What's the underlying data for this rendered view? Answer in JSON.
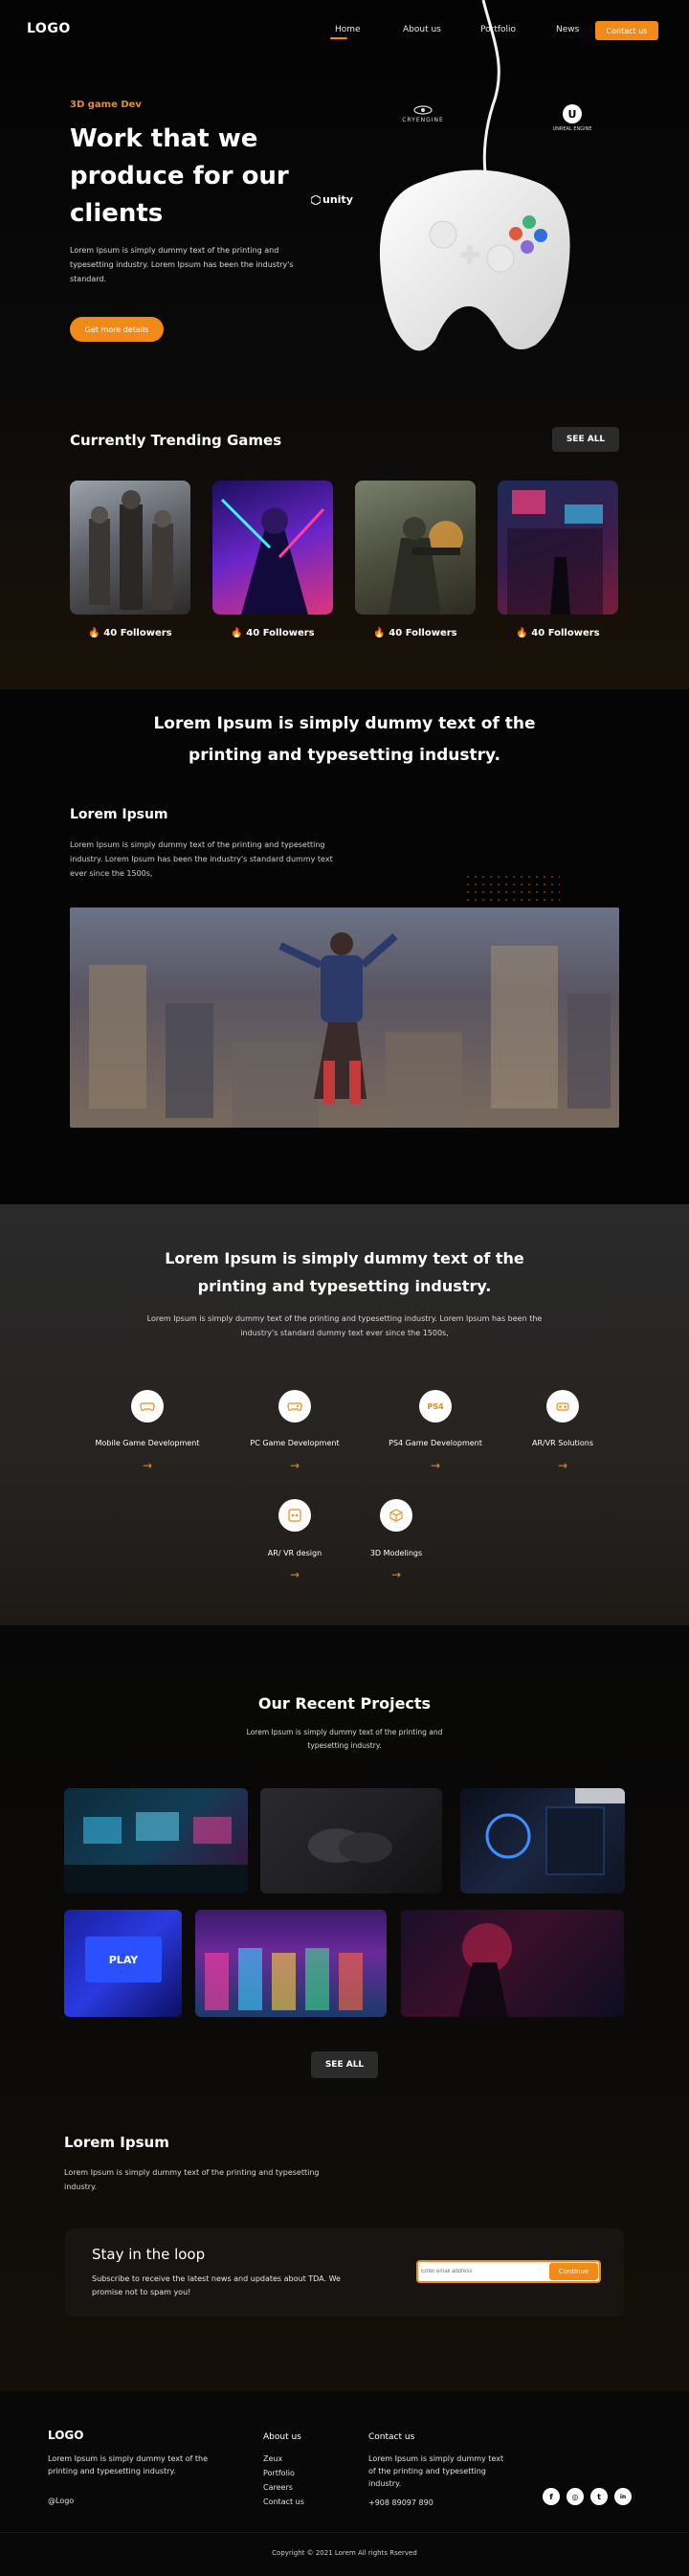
{
  "header": {
    "logo": "LOGO",
    "nav": [
      {
        "label": "Home",
        "active": true
      },
      {
        "label": "About us"
      },
      {
        "label": "Portfolio"
      },
      {
        "label": "News"
      }
    ],
    "contact_label": "Contact us",
    "accent": "#f28a1a"
  },
  "hero": {
    "kicker": "3D game Dev",
    "title": "Work that we produce for our clients",
    "text": "Lorem Ipsum is simply dummy text of the printing and typesetting industry. Lorem Ipsum has been the industry's standard.",
    "button": "Get more details",
    "brands": [
      "CRYENGINE",
      "unity",
      "UNREAL ENGINE"
    ]
  },
  "trending": {
    "title": "Currently Trending Games",
    "see_all": "SEE ALL",
    "cards": [
      {
        "followers": "40 Followers"
      },
      {
        "followers": "40 Followers"
      },
      {
        "followers": "40 Followers"
      },
      {
        "followers": "40 Followers"
      }
    ]
  },
  "statement": {
    "heading": "Lorem Ipsum is simply dummy text of the printing and typesetting industry."
  },
  "feature": {
    "title": "Lorem Ipsum",
    "text": "Lorem Ipsum is simply dummy text of the printing and typesetting industry. Lorem Ipsum has been the industry's standard dummy text ever since the 1500s,"
  },
  "services": {
    "title": "Lorem Ipsum is simply dummy text of the printing and typesetting industry.",
    "text": "Lorem Ipsum is simply dummy text of the printing and typesetting industry. Lorem Ipsum has been the industry's standard dummy text ever since the 1500s,",
    "items": [
      {
        "label": "Mobile Game Development",
        "icon": "gamepad-icon"
      },
      {
        "label": "PC Game Development",
        "icon": "gamepad-icon"
      },
      {
        "label": "PS4 Game Development",
        "icon": "ps4-icon"
      },
      {
        "label": "AR/VR Solutions",
        "icon": "vr-headset-icon"
      },
      {
        "label": "AR/ VR design",
        "icon": "vr-design-icon"
      },
      {
        "label": "3D Modelings",
        "icon": "cube-3d-icon"
      }
    ],
    "arrow": "→"
  },
  "projects": {
    "title": "Our Recent Projects",
    "text": "Lorem Ipsum is simply dummy text of the printing and typesetting industry.",
    "see_all": "SEE ALL",
    "play_text": "PLAY"
  },
  "about": {
    "title": "Lorem Ipsum",
    "text": "Lorem Ipsum is simply dummy text of the printing and typesetting industry."
  },
  "newsletter": {
    "title": "Stay in the loop",
    "text": "Subscribe to receive the latest news and updates about TDA. We promise not to spam you!",
    "placeholder": "Enter email address",
    "button": "Continue"
  },
  "footer": {
    "logo": "LOGO",
    "text": "Lorem Ipsum is simply dummy text of the printing and typesetting industry.",
    "handle": "@Logo",
    "about_head": "About us",
    "about_links": [
      "Zeux",
      "Portfolio",
      "Careers",
      "Contact us"
    ],
    "contact_head": "Contact us",
    "contact_text": "Lorem Ipsum is simply dummy text of the printing and typesetting industry.",
    "phone": "+908 89097 890",
    "social": [
      {
        "icon": "facebook-icon",
        "glyph": "f"
      },
      {
        "icon": "instagram-icon",
        "glyph": "◎"
      },
      {
        "icon": "twitter-icon",
        "glyph": "t"
      },
      {
        "icon": "linkedin-icon",
        "glyph": "in"
      }
    ],
    "copyright": "Copyright © 2021 Lorem All rights Rserved"
  }
}
